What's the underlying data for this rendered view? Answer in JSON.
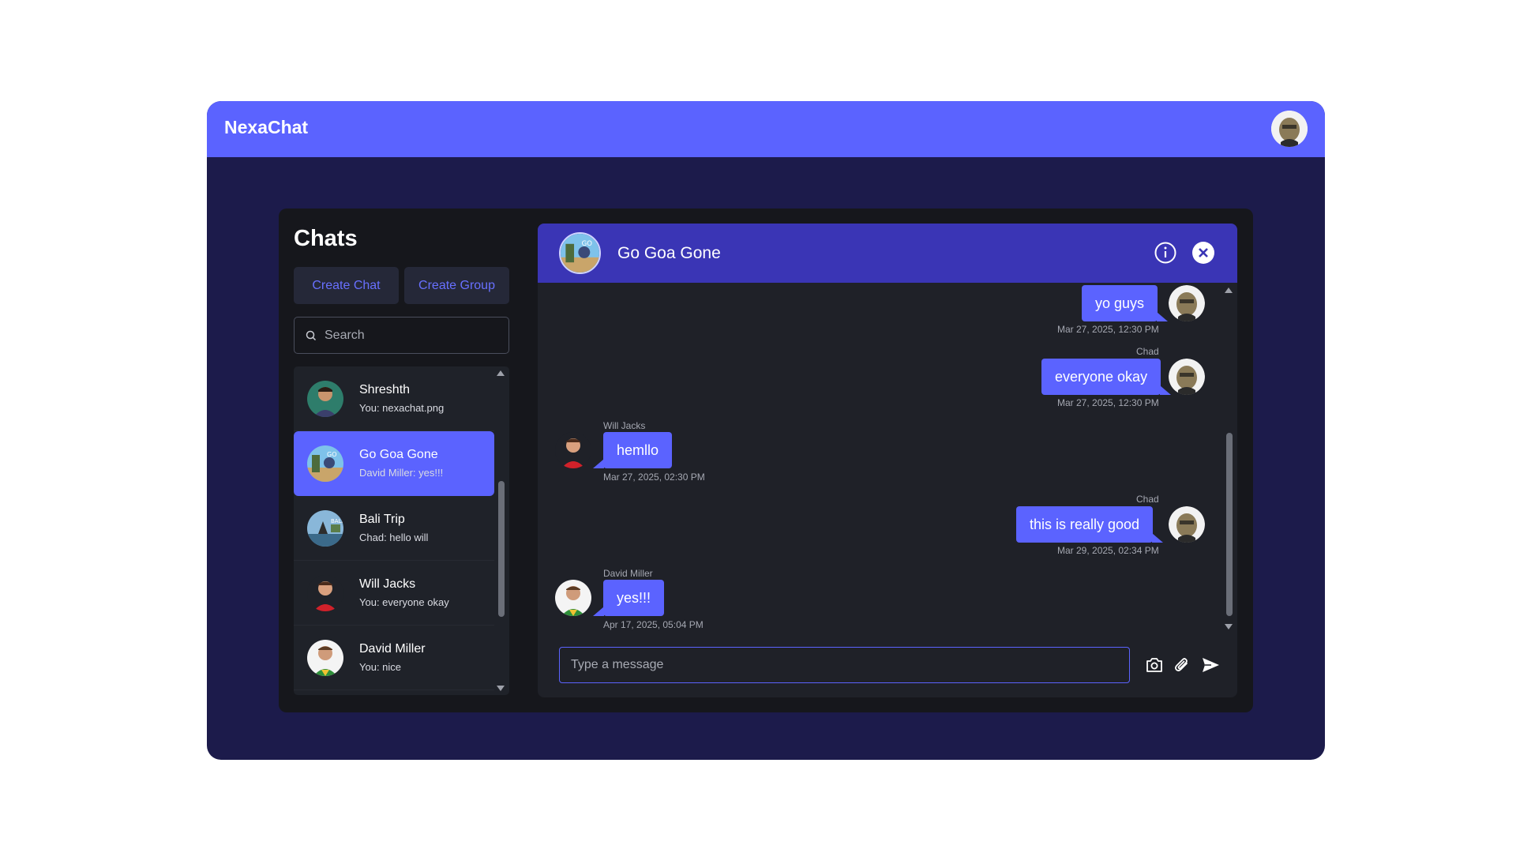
{
  "app": {
    "brand": "NexaChat"
  },
  "sidebar": {
    "title": "Chats",
    "create_chat_label": "Create Chat",
    "create_group_label": "Create Group",
    "search_placeholder": "Search",
    "chats": [
      {
        "name": "Shreshth",
        "last": "You: nexachat.png",
        "avatar": "person-green-bg"
      },
      {
        "name": "Go Goa Gone",
        "last": "David Miller: yes!!!",
        "avatar": "group-beach",
        "active": true
      },
      {
        "name": "Bali Trip",
        "last": "Chad: hello will",
        "avatar": "group-bali"
      },
      {
        "name": "Will Jacks",
        "last": "You: everyone okay",
        "avatar": "person-red-shirt"
      },
      {
        "name": "David Miller",
        "last": "You: nice",
        "avatar": "person-white-bg"
      }
    ]
  },
  "conversation": {
    "title": "Go Goa Gone",
    "messages": [
      {
        "text": "yo guys",
        "time": "Mar 27, 2025, 12:30 PM",
        "mine": true,
        "sender": ""
      },
      {
        "text": "everyone okay",
        "time": "Mar 27, 2025, 12:30 PM",
        "mine": true,
        "sender": "Chad"
      },
      {
        "text": "hemllo",
        "time": "Mar 27, 2025, 02:30 PM",
        "mine": false,
        "sender": "Will Jacks"
      },
      {
        "text": "this is really good",
        "time": "Mar 29, 2025, 02:34 PM",
        "mine": true,
        "sender": "Chad"
      },
      {
        "text": "yes!!!",
        "time": "Apr 17, 2025, 05:04 PM",
        "mine": false,
        "sender": "David Miller"
      }
    ],
    "composer_placeholder": "Type a message"
  },
  "colors": {
    "accent": "#5b63ff",
    "header_dark": "#3a35b5",
    "app_bg": "#1c1b4b",
    "panel_bg": "#16171c"
  }
}
